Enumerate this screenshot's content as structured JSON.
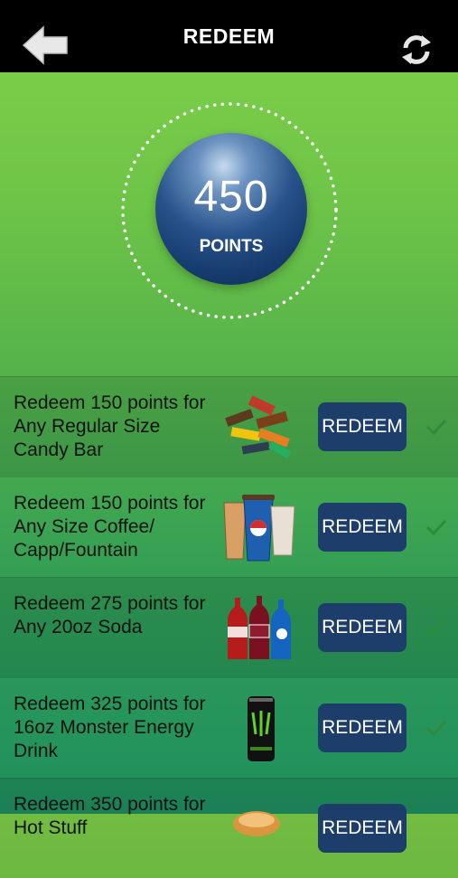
{
  "header": {
    "title": "REDEEM",
    "back_icon": "back-arrow-icon",
    "refresh_icon": "refresh-icon"
  },
  "balance": {
    "value": "450",
    "label": "POINTS"
  },
  "rewards": [
    {
      "text": "Redeem 150 points for Any Regular Size Candy Bar",
      "button": "REDEEM",
      "image": "candy-bars-image",
      "checked": true
    },
    {
      "text": "Redeem 150 points for Any Size Coffee/ Capp/Fountain",
      "button": "REDEEM",
      "image": "cups-image",
      "checked": true
    },
    {
      "text": "Redeem 275 points for Any 20oz Soda",
      "button": "REDEEM",
      "image": "soda-bottles-image",
      "checked": true
    },
    {
      "text": "Redeem 325 points for 16oz Monster Energy Drink",
      "button": "REDEEM",
      "image": "energy-drink-can-image",
      "checked": true
    },
    {
      "text": "Redeem 350 points for Hot Stuff",
      "button": "REDEEM",
      "image": "food-image",
      "checked": false
    }
  ],
  "colors": {
    "button": "#1d3e6b",
    "check": "#2e8b3a",
    "topbar": "#000000"
  }
}
